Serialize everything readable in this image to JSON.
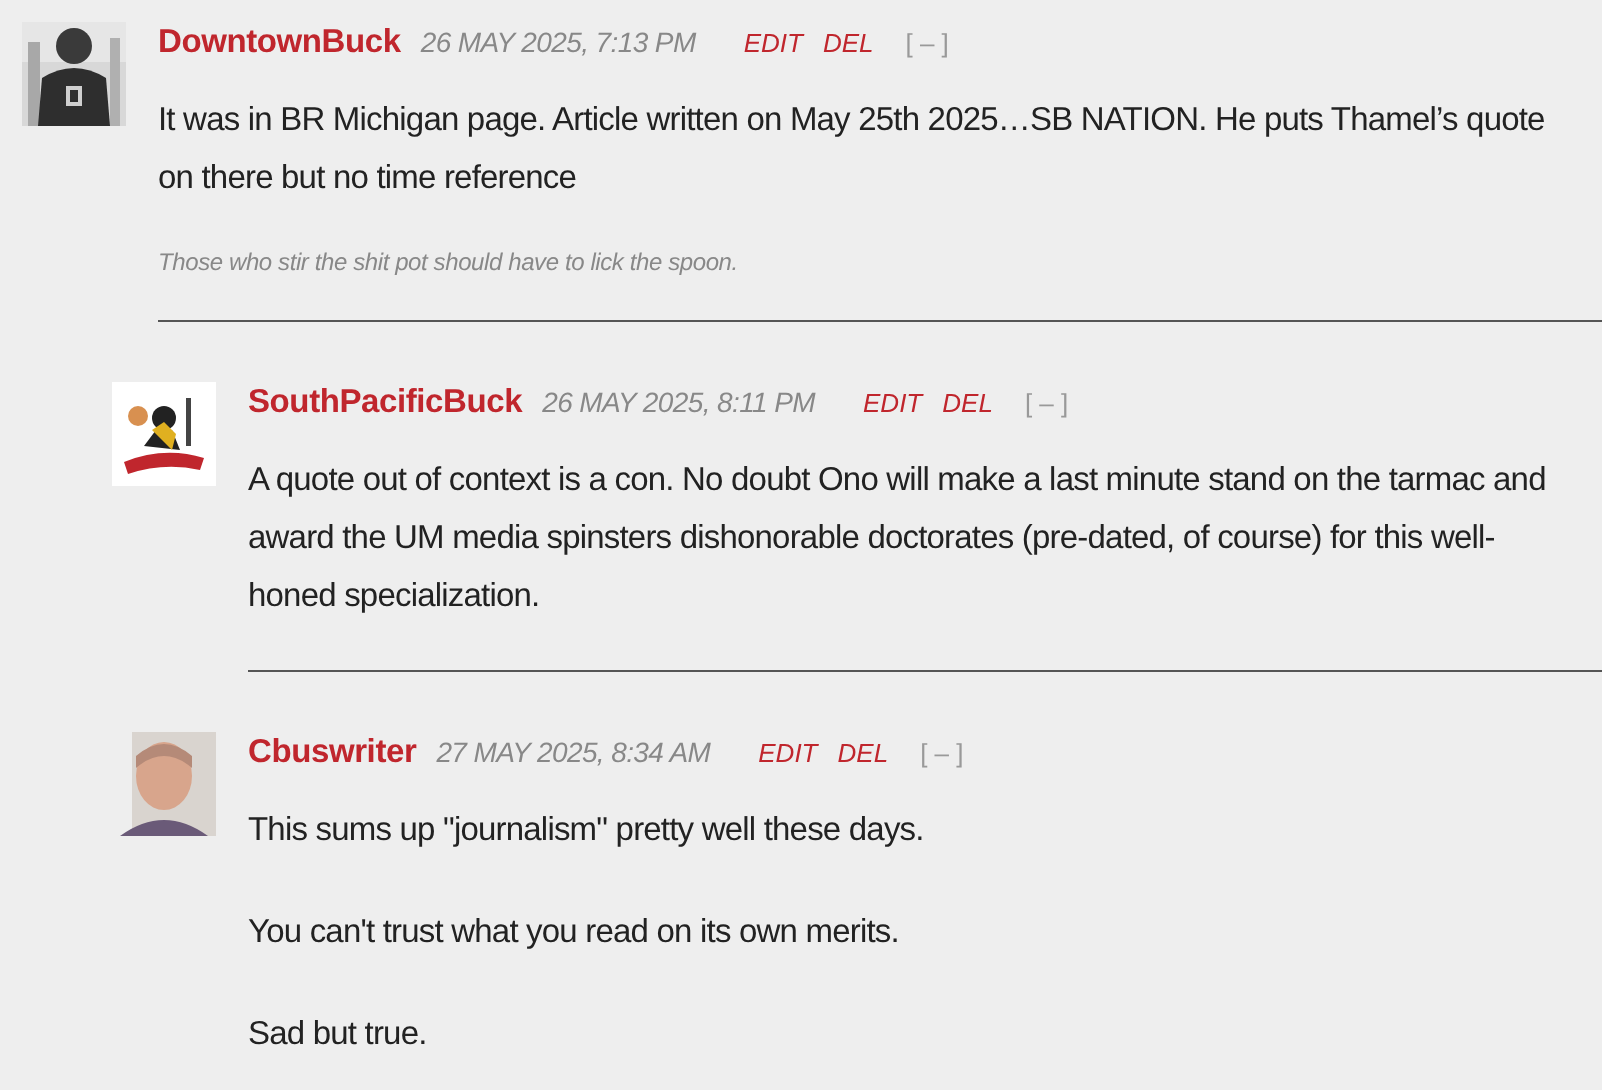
{
  "comments": [
    {
      "author": "DowntownBuck",
      "date": "26 MAY 2025, 7:13 PM",
      "actions": [
        "EDIT",
        "DEL"
      ],
      "collapse": "[ – ]",
      "avatar": {
        "kind": "picture"
      },
      "paragraphs": [
        "It was in BR Michigan page. Article written on May 25th 2025…SB NATION.  He puts Thamel’s quote on there but no time reference"
      ],
      "signature": "Those who stir the shit pot should have to lick the spoon.",
      "children": [
        {
          "author": "SouthPacificBuck",
          "date": "26 MAY 2025, 8:11 PM",
          "actions": [
            "EDIT",
            "DEL"
          ],
          "collapse": "[ – ]",
          "avatar": {
            "kind": "picture"
          },
          "paragraphs": [
            "A quote out of context is a con. No doubt Ono will make a last minute stand on the tarmac and award the UM media spinsters dishonorable doctorates (pre-dated, of course) for this well-honed specialization."
          ],
          "divider": true
        },
        {
          "author": "Cbuswriter",
          "date": "27 MAY 2025, 8:34 AM",
          "actions": [
            "EDIT",
            "DEL"
          ],
          "collapse": "[ – ]",
          "avatar": {
            "kind": "picture"
          },
          "paragraphs": [
            "This sums up \"journalism\" pretty well these days.",
            "You can't trust what you read on its own merits.",
            "Sad but true."
          ],
          "divider": false
        }
      ],
      "divider": true
    }
  ]
}
